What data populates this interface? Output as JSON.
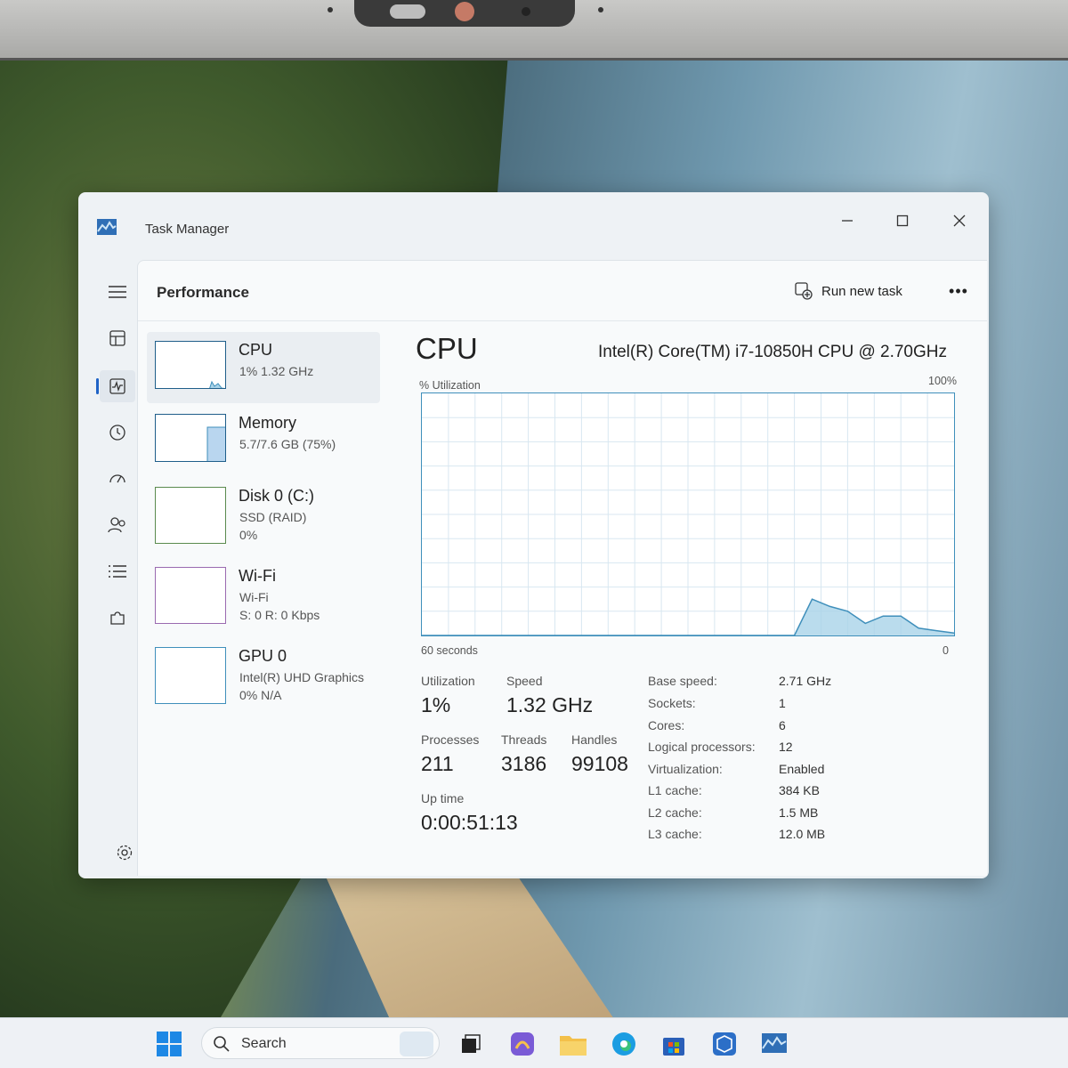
{
  "window": {
    "title": "Task Manager"
  },
  "header": {
    "page_title": "Performance",
    "run_task_label": "Run new task",
    "more_label": "•••"
  },
  "sidebar": [
    {
      "name": "CPU",
      "line1": "1%  1.32 GHz",
      "line2": ""
    },
    {
      "name": "Memory",
      "line1": "5.7/7.6 GB (75%)",
      "line2": ""
    },
    {
      "name": "Disk 0 (C:)",
      "line1": "SSD (RAID)",
      "line2": "0%"
    },
    {
      "name": "Wi-Fi",
      "line1": "Wi-Fi",
      "line2": "S: 0  R: 0 Kbps"
    },
    {
      "name": "GPU 0",
      "line1": "Intel(R) UHD Graphics",
      "line2": "0%  N/A"
    }
  ],
  "cpu": {
    "title": "CPU",
    "model": "Intel(R) Core(TM) i7-10850H CPU @ 2.70GHz",
    "graph_top_left": "% Utilization",
    "graph_top_right": "100%",
    "graph_bottom_left": "60 seconds",
    "graph_bottom_right": "0",
    "stats": {
      "utilization_label": "Utilization",
      "utilization_value": "1%",
      "speed_label": "Speed",
      "speed_value": "1.32 GHz",
      "processes_label": "Processes",
      "processes_value": "211",
      "threads_label": "Threads",
      "threads_value": "3186",
      "handles_label": "Handles",
      "handles_value": "99108",
      "uptime_label": "Up time",
      "uptime_value": "0:00:51:13"
    },
    "specs": [
      {
        "key": "Base speed:",
        "value": "2.71 GHz"
      },
      {
        "key": "Sockets:",
        "value": "1"
      },
      {
        "key": "Cores:",
        "value": "6"
      },
      {
        "key": "Logical processors:",
        "value": "12"
      },
      {
        "key": "Virtualization:",
        "value": "Enabled"
      },
      {
        "key": "L1 cache:",
        "value": "384 KB"
      },
      {
        "key": "L2 cache:",
        "value": "1.5 MB"
      },
      {
        "key": "L3 cache:",
        "value": "12.0 MB"
      }
    ]
  },
  "chart_data": {
    "type": "area",
    "x": [
      0,
      42,
      44,
      46,
      48,
      50,
      52,
      54,
      56,
      58,
      60
    ],
    "y": [
      0,
      0,
      15,
      12,
      10,
      5,
      8,
      8,
      3,
      2,
      1
    ],
    "xlim": [
      0,
      60
    ],
    "ylim": [
      0,
      100
    ],
    "grid": true
  },
  "taskbar": {
    "search_label": "Search"
  },
  "colors": {
    "accent": "#1f63c6",
    "graph_line": "#3f8fbb",
    "graph_fill": "#a9d3e8"
  }
}
